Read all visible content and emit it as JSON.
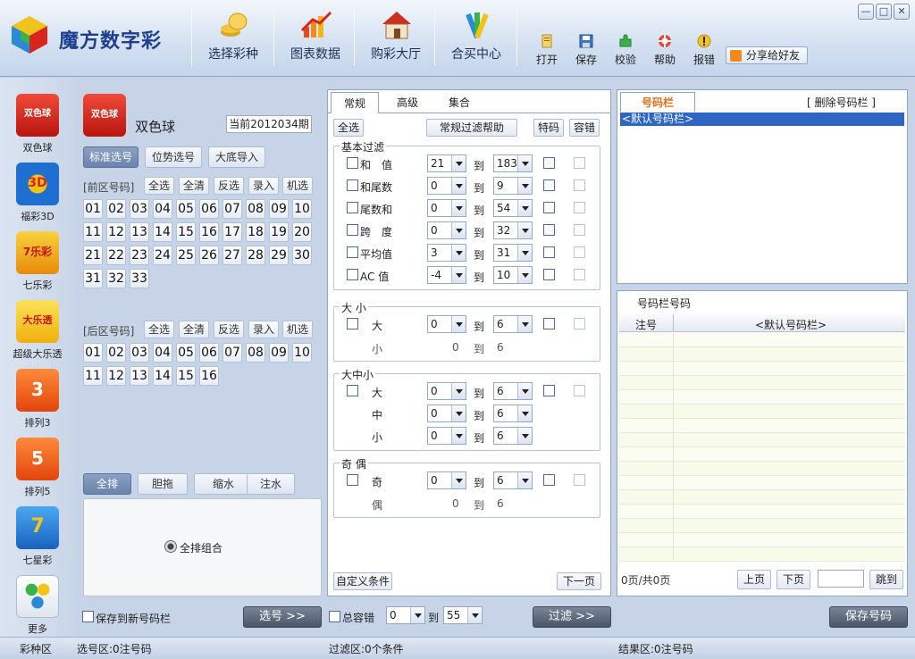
{
  "app": {
    "title": "魔方数字彩"
  },
  "nav": [
    {
      "label": "选择彩种",
      "icon": "coins-icon"
    },
    {
      "label": "图表数据",
      "icon": "chart-icon"
    },
    {
      "label": "购彩大厅",
      "icon": "house-icon"
    },
    {
      "label": "合买中心",
      "icon": "group-icon"
    }
  ],
  "tools": [
    {
      "label": "打开",
      "icon": "open-icon"
    },
    {
      "label": "保存",
      "icon": "save-icon"
    },
    {
      "label": "校验",
      "icon": "puzzle-icon"
    },
    {
      "label": "帮助",
      "icon": "help-lifebuoy-icon"
    },
    {
      "label": "报错",
      "icon": "warning-icon"
    }
  ],
  "share_label": "分享给好友",
  "window": {
    "min": "—",
    "max": "□",
    "close": "✕"
  },
  "sidebar": [
    {
      "label": "双色球",
      "logo": "双色球",
      "color": "#d9261c"
    },
    {
      "label": "福彩3D",
      "logo": "3D",
      "color": "#1e6fd0"
    },
    {
      "label": "七乐彩",
      "logo": "7乐彩",
      "color": "#e8a20c"
    },
    {
      "label": "超级大乐透",
      "logo": "大乐透",
      "color": "#f2c10e"
    },
    {
      "label": "排列3",
      "logo": "3",
      "color": "#f05a14"
    },
    {
      "label": "排列5",
      "logo": "5",
      "color": "#f05a14"
    },
    {
      "label": "七星彩",
      "logo": "7",
      "color": "#2a8de0"
    },
    {
      "label": "更多",
      "logo": "",
      "color": "#e9eef5"
    }
  ],
  "select": {
    "lottery_name": "双色球",
    "logo_text": "双色球",
    "period": "当前2012034期",
    "mode_tabs": [
      "标准选号",
      "位势选号",
      "大底导入"
    ],
    "front_label": "[前区号码]",
    "back_label": "[后区号码]",
    "actions": [
      "全选",
      "全清",
      "反选",
      "录入",
      "机选"
    ],
    "front_numbers": [
      "01",
      "02",
      "03",
      "04",
      "05",
      "06",
      "07",
      "08",
      "09",
      "10",
      "11",
      "12",
      "13",
      "14",
      "15",
      "16",
      "17",
      "18",
      "19",
      "20",
      "21",
      "22",
      "23",
      "24",
      "25",
      "26",
      "27",
      "28",
      "29",
      "30",
      "31",
      "32",
      "33"
    ],
    "back_numbers": [
      "01",
      "02",
      "03",
      "04",
      "05",
      "06",
      "07",
      "08",
      "09",
      "10",
      "11",
      "12",
      "13",
      "14",
      "15",
      "16"
    ],
    "bottom_tabs": [
      "全排",
      "胆拖",
      "缩水",
      "注水"
    ],
    "radio_label": "全排组合",
    "save_new_label": "保存到新号码栏",
    "select_btn": "选号 >>"
  },
  "filter": {
    "tabs": [
      "常规",
      "高级",
      "集合"
    ],
    "select_all": "全选",
    "help": "常规过滤帮助",
    "special": "特码",
    "tolerance": "容错",
    "basic_title": "基本过滤",
    "to": "到",
    "basic_rows": [
      {
        "label": "和　值",
        "from": "21",
        "to": "183"
      },
      {
        "label": "和尾数",
        "from": "0",
        "to": "9"
      },
      {
        "label": "尾数和",
        "from": "0",
        "to": "54"
      },
      {
        "label": "跨　度",
        "from": "0",
        "to": "32"
      },
      {
        "label": "平均值",
        "from": "3",
        "to": "31"
      },
      {
        "label": "AC 值",
        "from": "-4",
        "to": "10"
      }
    ],
    "size_title": "大 小",
    "size_big": {
      "label": "大",
      "from": "0",
      "to": "6"
    },
    "size_small": {
      "label": "小",
      "from": "0",
      "to": "6"
    },
    "bms_title": "大中小",
    "bms_rows": [
      {
        "label": "大",
        "from": "0",
        "to": "6"
      },
      {
        "label": "中",
        "from": "0",
        "to": "6"
      },
      {
        "label": "小",
        "from": "0",
        "to": "6"
      }
    ],
    "oe_title": "奇 偶",
    "oe_odd": {
      "label": "奇",
      "from": "0",
      "to": "6"
    },
    "oe_even": {
      "label": "偶",
      "from": "0",
      "to": "6"
    },
    "custom": "自定义条件",
    "next": "下一页",
    "total_tol_label": "总容错",
    "total_from": "0",
    "total_to": "55",
    "filter_btn": "过滤 >>"
  },
  "numbar": {
    "tab": "号码栏",
    "delete": "[ 删除号码栏 ]",
    "default_item": "<默认号码栏>"
  },
  "numlist": {
    "title": "号码栏号码",
    "col_note": "注号",
    "col_default": "<默认号码栏>",
    "page_info": "0页/共0页",
    "prev": "上页",
    "next": "下页",
    "goto": "跳到",
    "save": "保存号码"
  },
  "status": {
    "zone": "彩种区",
    "select": "选号区:0注号码",
    "filter": "过滤区:0个条件",
    "result": "结果区:0注号码"
  }
}
